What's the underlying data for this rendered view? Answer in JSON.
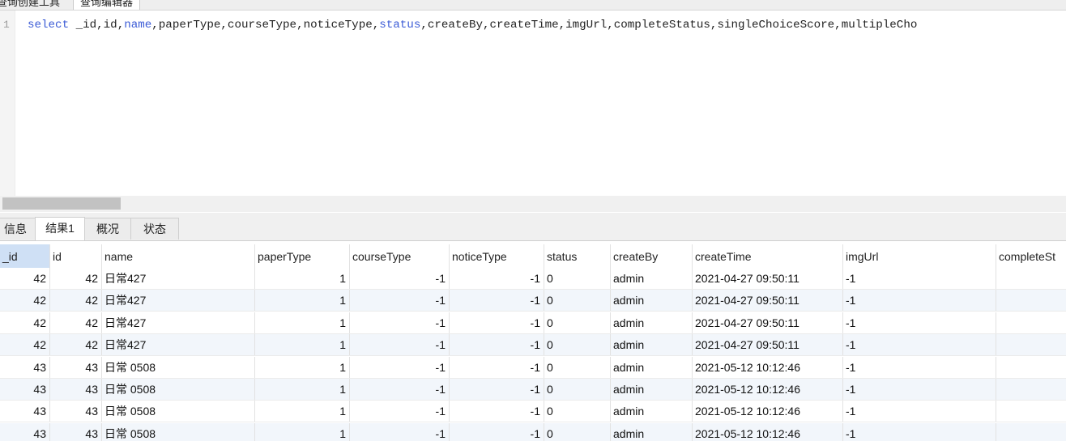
{
  "editor_tabs": [
    "查询创建工具",
    "查询编辑器"
  ],
  "editor": {
    "line_number": "1",
    "sql_tokens": [
      {
        "text": "select",
        "kw": true
      },
      {
        "text": " _id,id,",
        "kw": false
      },
      {
        "text": "name",
        "kw": true
      },
      {
        "text": ",paperType,courseType,noticeType,",
        "kw": false
      },
      {
        "text": "status",
        "kw": true
      },
      {
        "text": ",createBy,createTime,imgUrl,completeStatus,singleChoiceScore,multipleCho",
        "kw": false
      }
    ]
  },
  "result_tabs": [
    {
      "label": "信息",
      "active": false
    },
    {
      "label": "结果1",
      "active": true
    },
    {
      "label": "概况",
      "active": false
    },
    {
      "label": "状态",
      "active": false
    }
  ],
  "columns": [
    "_id",
    "id",
    "name",
    "paperType",
    "courseType",
    "noticeType",
    "status",
    "createBy",
    "createTime",
    "imgUrl",
    "completeSt"
  ],
  "rows": [
    [
      "42",
      "42",
      "日常427",
      "1",
      "-1",
      "-1",
      "0",
      "admin",
      "2021-04-27 09:50:11",
      "-1",
      ""
    ],
    [
      "42",
      "42",
      "日常427",
      "1",
      "-1",
      "-1",
      "0",
      "admin",
      "2021-04-27 09:50:11",
      "-1",
      ""
    ],
    [
      "42",
      "42",
      "日常427",
      "1",
      "-1",
      "-1",
      "0",
      "admin",
      "2021-04-27 09:50:11",
      "-1",
      ""
    ],
    [
      "42",
      "42",
      "日常427",
      "1",
      "-1",
      "-1",
      "0",
      "admin",
      "2021-04-27 09:50:11",
      "-1",
      ""
    ],
    [
      "43",
      "43",
      "日常 0508",
      "1",
      "-1",
      "-1",
      "0",
      "admin",
      "2021-05-12 10:12:46",
      "-1",
      ""
    ],
    [
      "43",
      "43",
      "日常 0508",
      "1",
      "-1",
      "-1",
      "0",
      "admin",
      "2021-05-12 10:12:46",
      "-1",
      ""
    ],
    [
      "43",
      "43",
      "日常 0508",
      "1",
      "-1",
      "-1",
      "0",
      "admin",
      "2021-05-12 10:12:46",
      "-1",
      ""
    ],
    [
      "43",
      "43",
      "日常 0508",
      "1",
      "-1",
      "-1",
      "0",
      "admin",
      "2021-05-12 10:12:46",
      "-1",
      ""
    ]
  ],
  "colors": {
    "keyword": "#3b5bd6",
    "selected_header": "#cfe0f5",
    "alt_row": "#f2f6fb"
  }
}
